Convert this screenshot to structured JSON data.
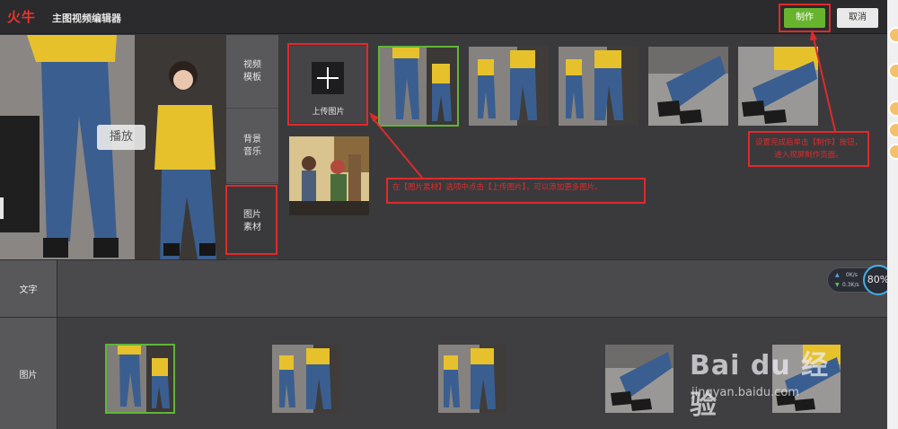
{
  "header": {
    "logo": "火牛",
    "title": "主图视频编辑器",
    "make_label": "制作",
    "cancel_label": "取消"
  },
  "preview": {
    "play_label": "播放"
  },
  "tabs": [
    {
      "label": "视频\n模板"
    },
    {
      "label": "背景\n音乐"
    },
    {
      "label": "图片\n素材"
    }
  ],
  "materials": {
    "upload_label": "上传图片"
  },
  "annotations": {
    "upload_tip": "在【图片素材】选项中点击【上传图片】，可以添加更多图片。",
    "make_tip": "设置完成后单击【制作】按钮，进入视屏制作页面。"
  },
  "tracks": {
    "text_label": "文字",
    "image_label": "图片"
  },
  "net_widget": {
    "up": "0K/s",
    "down": "0.3K/s",
    "percent": "80%"
  },
  "watermark": {
    "brand": "Bai du 经验",
    "url": "jingyan.baidu.com"
  },
  "colors": {
    "accent_green": "#67b32e",
    "annotation_red": "#e02a2a",
    "selection_green": "#5fb636"
  }
}
